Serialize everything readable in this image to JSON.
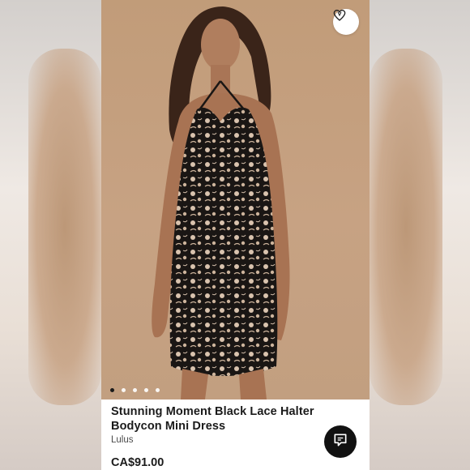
{
  "product": {
    "title": "Stunning Moment Black Lace Halter Bodycon Mini Dress",
    "brand": "Lulus",
    "price": "CA$91.00"
  },
  "carousel": {
    "total_images": 5,
    "active_index": 0
  },
  "icons": {
    "wishlist": "heart-icon",
    "chat": "chat-bubble-icon"
  },
  "colors": {
    "background_photo": "#c6a283",
    "text": "#1b1b1b",
    "chat_button": "#111111"
  }
}
